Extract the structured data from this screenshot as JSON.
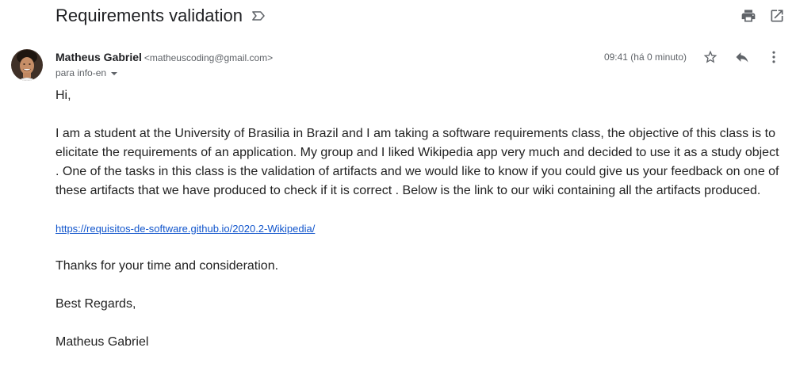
{
  "email": {
    "subject": "Requirements validation",
    "sender": {
      "name": "Matheus Gabriel",
      "email": "<matheuscoding@gmail.com>"
    },
    "recipient": "para info-en",
    "timestamp": "09:41 (há 0 minuto)"
  },
  "body": {
    "greeting": "Hi,",
    "main": "I am a student at the University of Brasilia in Brazil and I am taking a software requirements class, the objective of this class is to elicitate the requirements of an application. My group and I liked Wikipedia app very much and decided to use it as a study object . One of the tasks in this class is the validation of artifacts and we would like to know if you could give us your feedback on one of these artifacts that we have produced to check if it is correct . Below is  the link to our wiki containing all the artifacts produced.",
    "link": "https://requisitos-de-software.github.io/2020.2-Wikipedia/",
    "thanks": "Thanks for your time and consideration.",
    "regards": "Best Regards,",
    "signature": "Matheus Gabriel"
  },
  "icons": {
    "label": "label-outline-icon",
    "print": "print-icon",
    "open_new_window": "open-in-new-window-icon",
    "star": "star-outline-icon",
    "reply": "reply-icon",
    "more": "more-vert-icon"
  },
  "colors": {
    "link": "#1155cc",
    "icon": "#5f6368",
    "text": "#222222"
  }
}
